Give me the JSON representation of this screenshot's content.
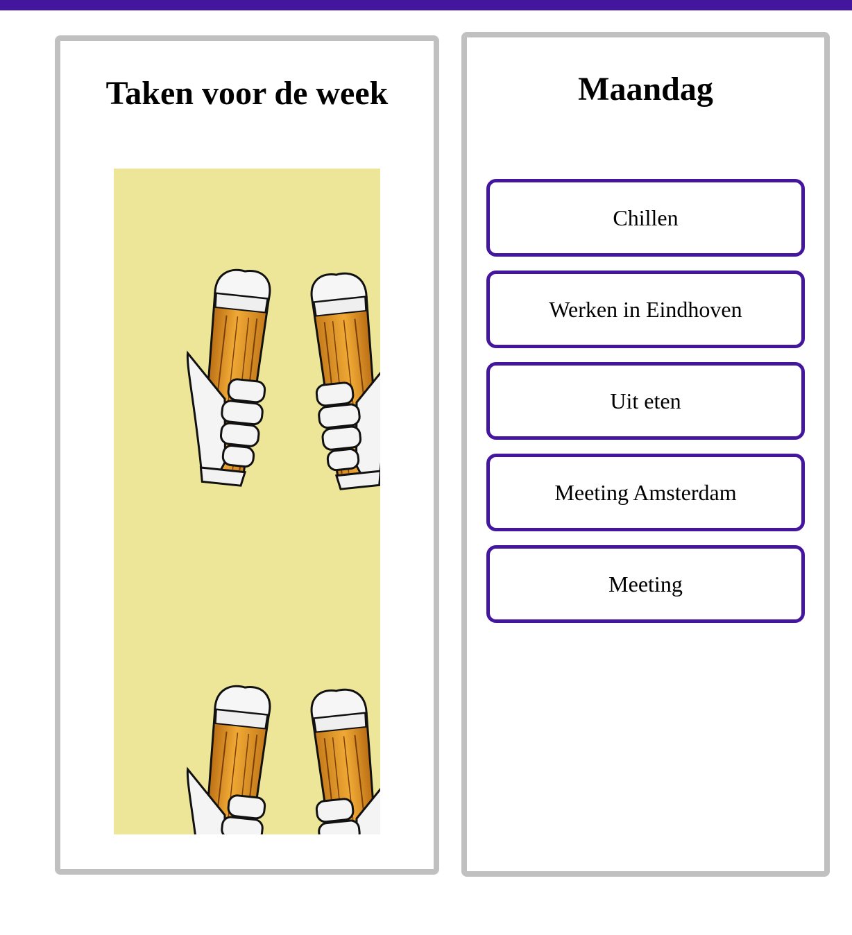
{
  "colors": {
    "accent": "#44169e",
    "panel_border": "#c0c0c0",
    "image_background": "#ede698"
  },
  "left_panel": {
    "title": "Taken voor de week",
    "image": "beer-toast-pattern"
  },
  "right_panel": {
    "title": "Maandag",
    "tasks": [
      "Chillen",
      "Werken in Eindhoven",
      "Uit eten",
      "Meeting Amsterdam",
      "Meeting"
    ]
  }
}
